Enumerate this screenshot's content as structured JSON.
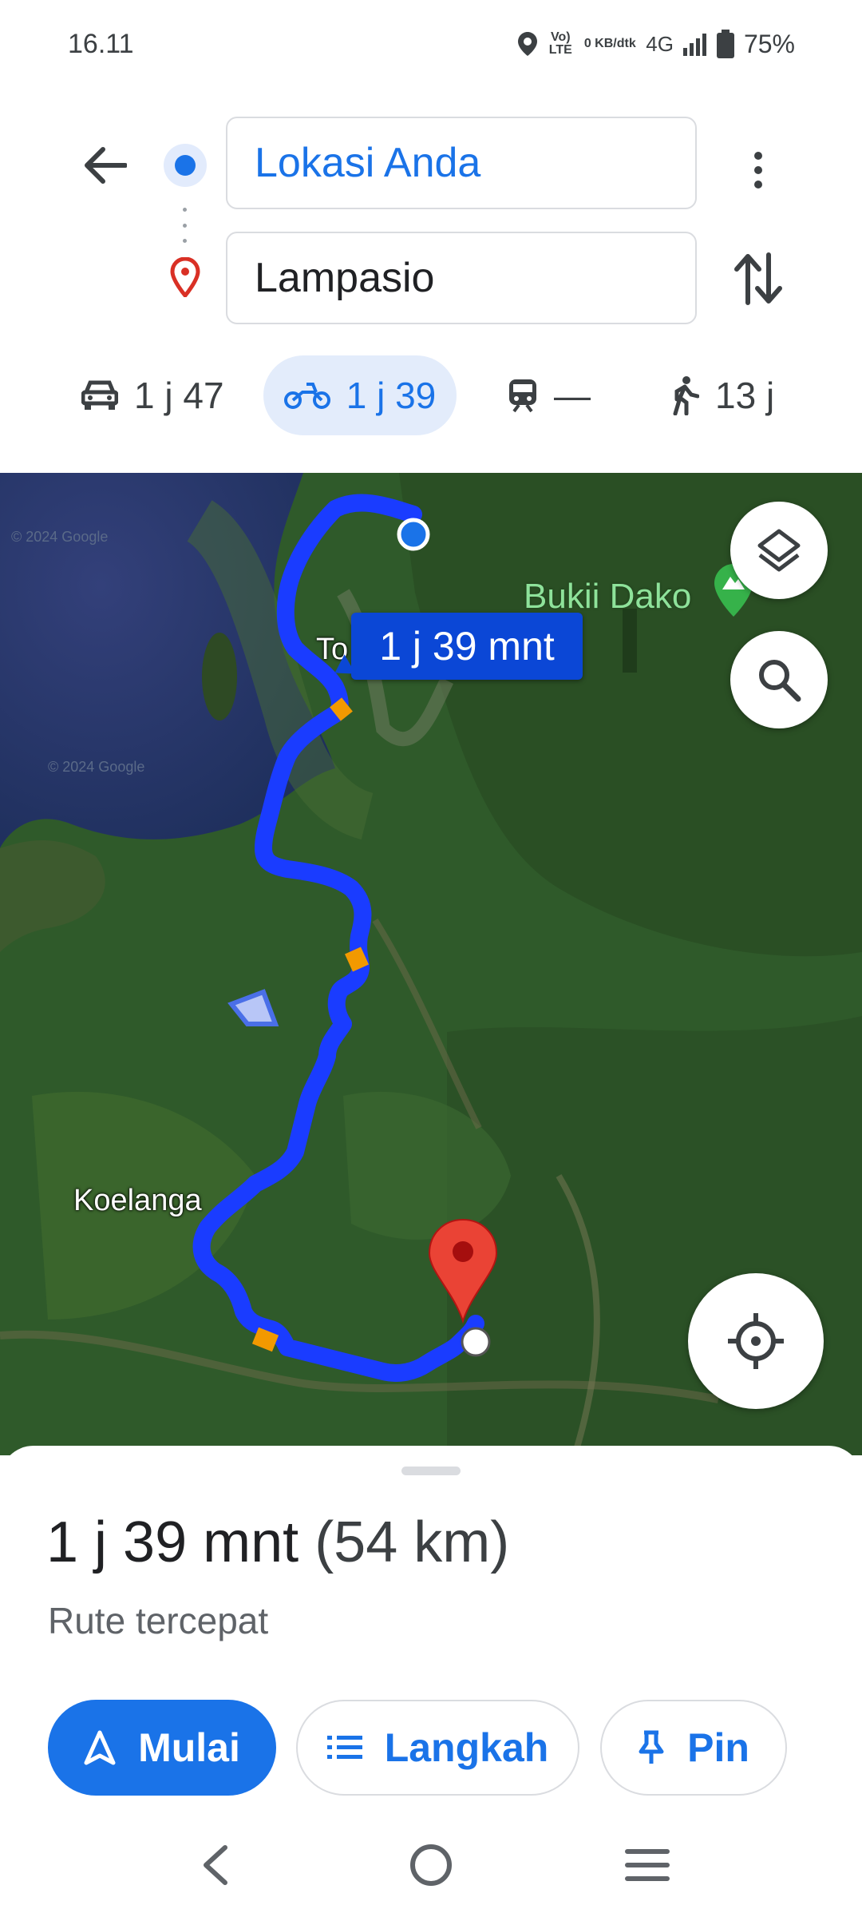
{
  "status_bar": {
    "time": "16.11",
    "volte": "Vo) LTE",
    "data_speed": "0 KB/dtk",
    "network": "4G",
    "battery": "75%"
  },
  "search": {
    "origin": "Lokasi Anda",
    "destination": "Lampasio"
  },
  "modes": [
    {
      "name": "car",
      "label": "1 j 47"
    },
    {
      "name": "motorcycle",
      "label": "1 j 39",
      "selected": true
    },
    {
      "name": "transit",
      "label": "—"
    },
    {
      "name": "walk",
      "label": "13 j"
    }
  ],
  "map": {
    "watermark_1": "© 2024 Google",
    "watermark_2": "© 2024 Google",
    "place_to": "To",
    "place_bukit": "Bukii Dako",
    "place_koelanga": "Koelanga",
    "route_time_bubble": "1 j 39 mnt"
  },
  "sheet": {
    "duration": "1 j 39 mnt",
    "distance": "(54 km)",
    "route_desc": "Rute tercepat",
    "start_label": "Mulai",
    "steps_label": "Langkah",
    "pin_label": "Pin"
  },
  "colors": {
    "accent": "#1a73e8",
    "route": "#1a3cff",
    "traffic": "#f29900",
    "destination_pin": "#ea4335"
  }
}
